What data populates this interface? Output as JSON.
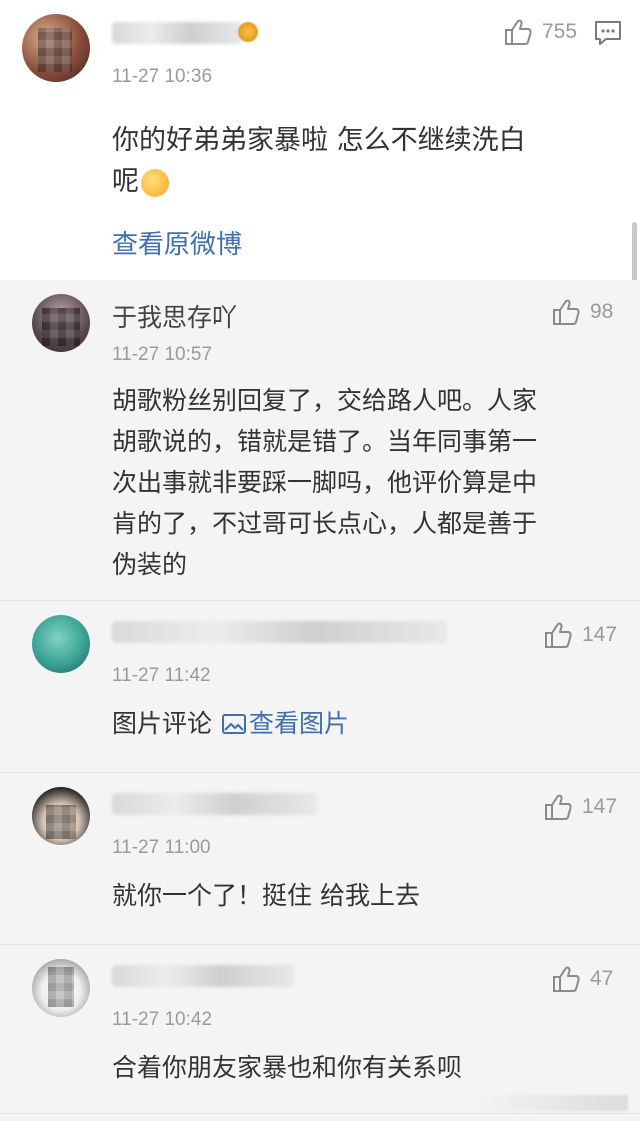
{
  "main_post": {
    "time": "11-27 10:36",
    "content": "你的好弟弟家暴啦 怎么不继续洗白",
    "content_line2": "呢",
    "view_link": "查看原微博",
    "likes": "755"
  },
  "replies": [
    {
      "name": "于我思存吖",
      "time": "11-27 10:57",
      "likes": "98",
      "lines": [
        "胡歌粉丝别回复了，交给路人吧。人家",
        "胡歌说的，错就是错了。当年同事第一",
        "次出事就非要踩一脚吗，他评价算是中",
        "肯的了，不过哥可长点心，人都是善于",
        "伪装的"
      ]
    },
    {
      "time": "11-27 11:42",
      "likes": "147",
      "text": "图片评论",
      "image_link": "查看图片"
    },
    {
      "time": "11-27 11:00",
      "likes": "147",
      "text": "就你一个了！挺住 给我上去"
    },
    {
      "time": "11-27 10:42",
      "likes": "47",
      "text": "合着你朋友家暴也和你有关系呗"
    }
  ],
  "colors": {
    "link": "#3d6fb2",
    "meta": "#9a9a9a",
    "text": "#333333",
    "reply_bg": "#f4f4f4"
  },
  "icons": [
    "thumbs-up-icon",
    "comment-icon",
    "image-icon"
  ]
}
